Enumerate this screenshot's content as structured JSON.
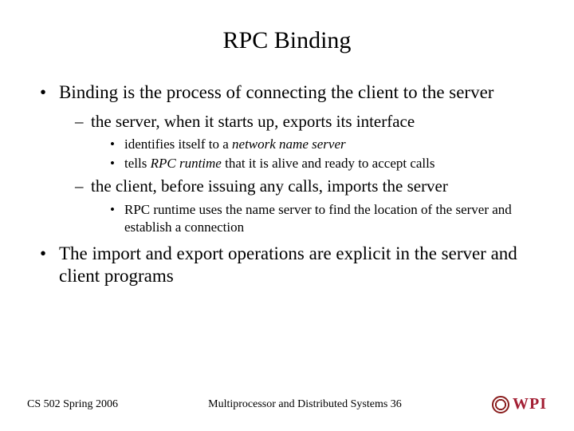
{
  "title": "RPC Binding",
  "bullets": {
    "b1": "Binding is the process of connecting the client to the server",
    "b1_1": "the server, when it starts up, exports its interface",
    "b1_1_1_pre": "identifies itself to a ",
    "b1_1_1_em": "network name server",
    "b1_1_2_pre": "tells ",
    "b1_1_2_em": "RPC runtime",
    "b1_1_2_post": " that it is alive and ready to accept calls",
    "b1_2": "the client, before issuing any calls, imports the server",
    "b1_2_1": "RPC runtime uses the name server to find the location of the server and establish a connection",
    "b2": "The import and export operations are explicit in the server and client programs"
  },
  "footer": {
    "left": "CS 502 Spring 2006",
    "center": "Multiprocessor and Distributed Systems  36",
    "logo": "WPI"
  }
}
